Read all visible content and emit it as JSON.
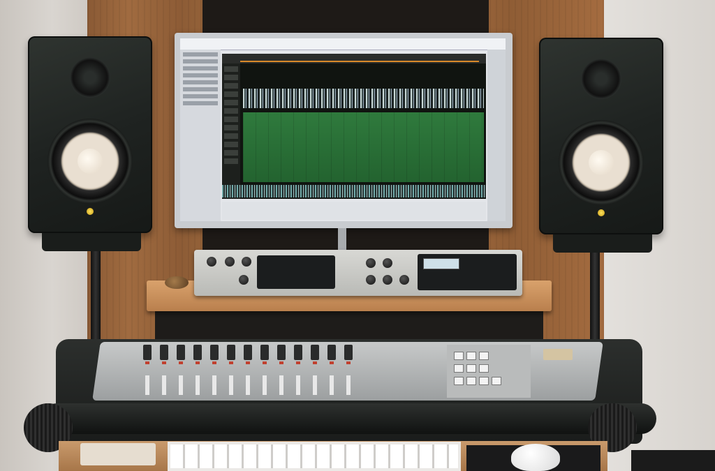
{
  "scene": {
    "description_hidden": "",
    "colors": {
      "wood": "#a06b40",
      "daw_green": "#2f7a3d",
      "console_gray": "#b9bbbb",
      "speaker_body": "#1f2321",
      "woofer_cone": "#e9dfd1"
    },
    "icons": [
      "speaker-left-icon",
      "speaker-right-icon",
      "monitor-icon",
      "mixer-icon",
      "keyboard-icon",
      "mouse-icon"
    ]
  }
}
